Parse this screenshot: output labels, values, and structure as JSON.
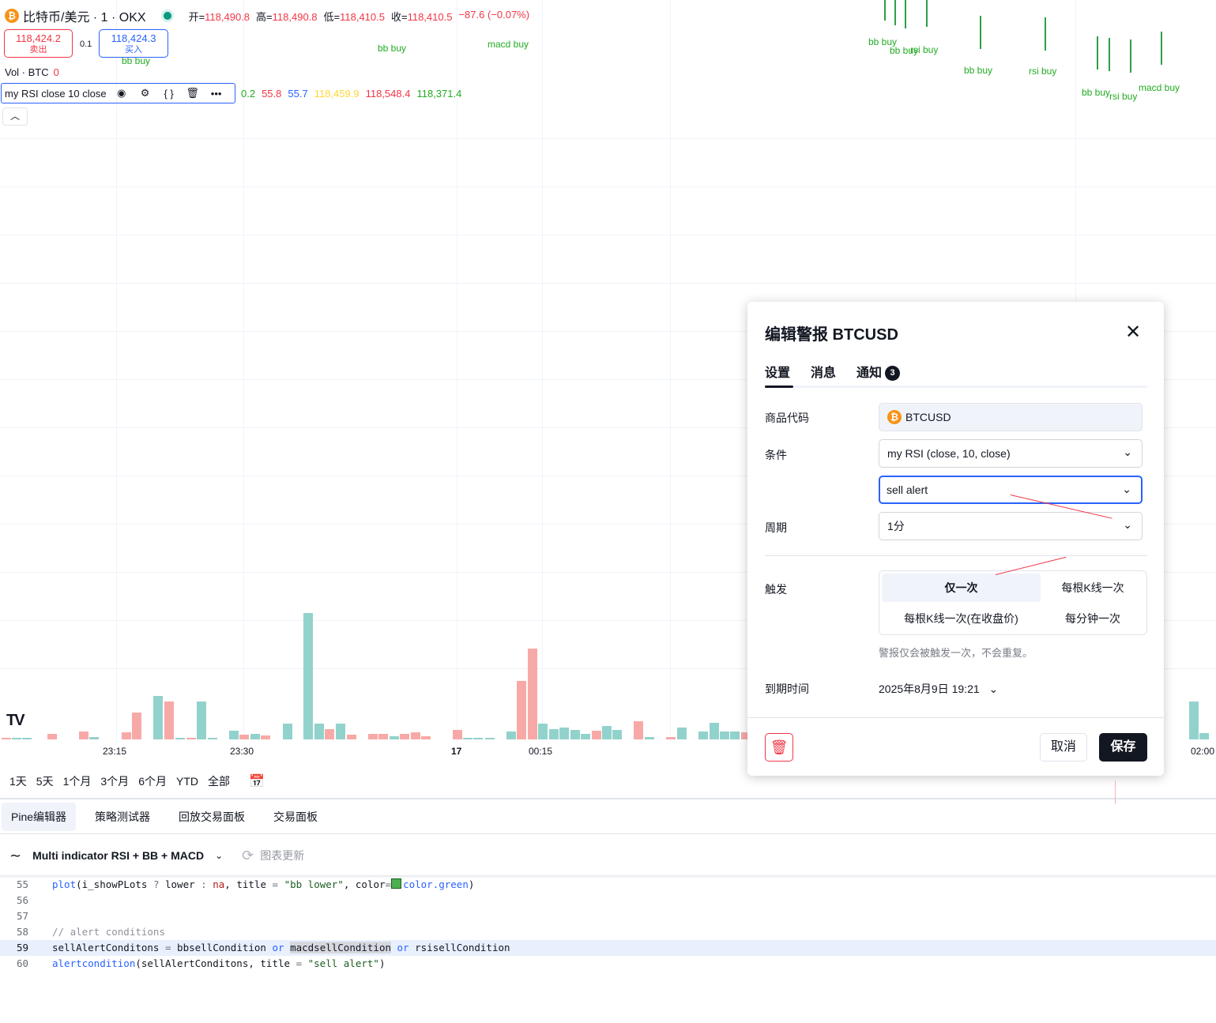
{
  "symbol": {
    "icon": "bitcoin-icon",
    "name": "比特币/美元 · 1 · OKX",
    "ohlc": [
      {
        "key": "开=",
        "value": "118,490.8"
      },
      {
        "key": "高=",
        "value": "118,490.8"
      },
      {
        "key": "低=",
        "value": "118,410.5"
      },
      {
        "key": "收=",
        "value": "118,410.5"
      },
      {
        "key": "",
        "value": "−87.6 (−0.07%)"
      }
    ]
  },
  "prices": {
    "sell_value": "118,424.2",
    "sell_label": "卖出",
    "spread": "0.1",
    "buy_value": "118,424.3",
    "buy_label": "买入"
  },
  "volume": {
    "label": "Vol · BTC",
    "value": "0"
  },
  "indicator": {
    "name": "my RSI close 10 close",
    "values": [
      {
        "text": "0.2",
        "color": "#22ab22"
      },
      {
        "text": "55.8",
        "color": "#f23645"
      },
      {
        "text": "55.7",
        "color": "#2962ff"
      },
      {
        "text": "118,459.9",
        "color": "#fdd835"
      },
      {
        "text": "118,548.4",
        "color": "#f23645"
      },
      {
        "text": "118,371.4",
        "color": "#22ab22"
      }
    ]
  },
  "signals": [
    "bb buy",
    "macd buy",
    "bb buy",
    "bb buy",
    "rsi buy",
    "bb buy",
    "rsi buy",
    "bb buy",
    "rsi buy",
    "macd buy",
    "bb buy"
  ],
  "time_axis": [
    "23:15",
    "23:30",
    "17",
    "00:15",
    "02:00"
  ],
  "range_buttons": [
    "1天",
    "5天",
    "1个月",
    "3个月",
    "6个月",
    "YTD",
    "全部"
  ],
  "bottom_tabs": [
    "Pine编辑器",
    "策略测试器",
    "回放交易面板",
    "交易面板"
  ],
  "editor": {
    "script_name": "Multi indicator RSI + BB + MACD",
    "update_label": "图表更新"
  },
  "code_line_numbers": [
    "55",
    "56",
    "57",
    "58",
    "59",
    "60"
  ],
  "code": {
    "l55": [
      "plot",
      "(i_showPLots ",
      "?",
      " lower ",
      ":",
      " ",
      "na",
      ", title ",
      "=",
      " ",
      "\"bb lower\"",
      ", color",
      "=",
      "color.green",
      ")"
    ],
    "l58": "// alert conditions",
    "l59": [
      "sellAlertConditons ",
      "=",
      " bbsellCondition ",
      "or",
      " ",
      "macdsellCondition",
      " ",
      "or",
      " rsisellCondition"
    ],
    "l60": [
      "alertcondition",
      "(sellAlertConditons, title ",
      "=",
      " ",
      "\"sell alert\"",
      ")"
    ]
  },
  "dialog": {
    "title": "编辑警报 BTCUSD",
    "tabs": [
      "设置",
      "消息",
      "通知"
    ],
    "notify_badge": "3",
    "symbol_label": "商品代码",
    "symbol_value": "BTCUSD",
    "condition_label": "条件",
    "condition_value": "my RSI (close, 10, close)",
    "condition_sub_value": "sell alert",
    "period_label": "周期",
    "period_value": "1分",
    "trigger_label": "触发",
    "trigger_options": [
      "仅一次",
      "每根K线一次",
      "每根K线一次(在收盘价)",
      "每分钟一次"
    ],
    "trigger_selected": "仅一次",
    "hint": "警报仅会被触发一次，不会重复。",
    "expiry_label": "到期时间",
    "expiry_value": "2025年8月9日 19:21",
    "cancel": "取消",
    "save": "保存"
  },
  "colors": {
    "up": "#089981",
    "down": "#f23645",
    "accent": "#2962ff",
    "signal": "#22ab22"
  }
}
